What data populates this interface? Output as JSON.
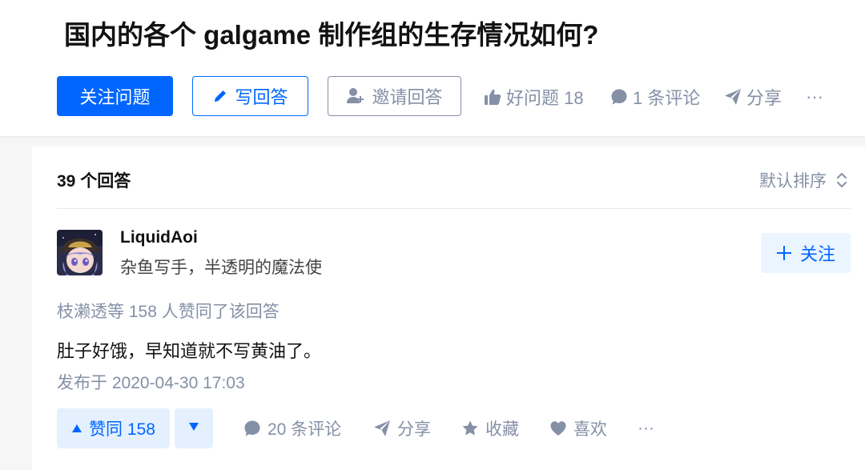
{
  "question": {
    "title": "国内的各个 galgame 制作组的生存情况如何?",
    "follow_label": "关注问题",
    "write_label": "写回答",
    "invite_label": "邀请回答",
    "good_question_label": "好问题 18",
    "comments_label": "1 条评论",
    "share_label": "分享",
    "more_label": "···"
  },
  "answers": {
    "count_label": "39 个回答",
    "sort_label": "默认排序"
  },
  "answer": {
    "author_name": "LiquidAoi",
    "author_bio": "杂鱼写手，半透明的魔法使",
    "follow_label": "关注",
    "likers_text": "枝濑透等 158 人赞同了该回答",
    "content": "肚子好饿，早知道就不写黄油了。",
    "published": "发布于 2020-04-30 17:03",
    "upvote_label": "赞同 158",
    "comments_label": "20 条评论",
    "share_label": "分享",
    "collect_label": "收藏",
    "like_label": "喜欢",
    "more_label": "···"
  },
  "colors": {
    "primary": "#0066ff",
    "muted": "#8590a6",
    "upvote_bg": "#e5f0ff",
    "follow_user_bg": "#ebf5ff"
  },
  "icons": [
    "pencil-icon",
    "invite-user-icon",
    "thumbs-up-icon",
    "comment-icon",
    "share-icon",
    "sort-icon",
    "plus-icon",
    "upvote-triangle-icon",
    "downvote-triangle-icon",
    "star-icon",
    "heart-icon"
  ]
}
